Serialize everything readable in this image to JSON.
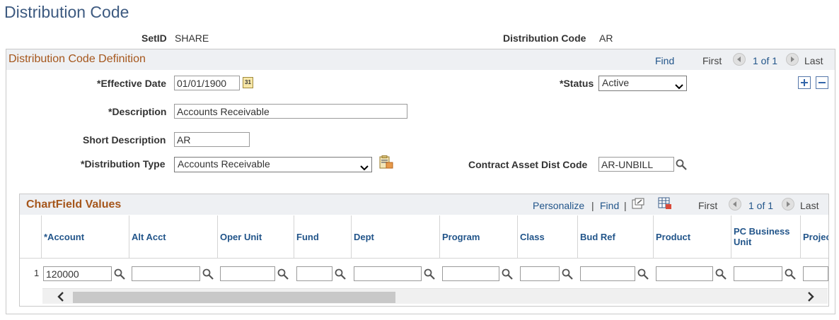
{
  "page_title": "Distribution Code",
  "header": {
    "setid_label": "SetID",
    "setid_value": "SHARE",
    "distcode_label": "Distribution Code",
    "distcode_value": "AR"
  },
  "definition": {
    "title": "Distribution Code Definition",
    "nav": {
      "find": "Find",
      "first": "First",
      "count": "1 of 1",
      "last": "Last"
    },
    "effective_date_label": "*Effective Date",
    "effective_date_value": "01/01/1900",
    "calendar_day": "31",
    "status_label": "*Status",
    "status_value": "Active",
    "description_label": "*Description",
    "description_value": "Accounts Receivable",
    "short_desc_label": "Short Description",
    "short_desc_value": "AR",
    "dist_type_label": "*Distribution Type",
    "dist_type_value": "Accounts Receivable",
    "contract_label": "Contract Asset Dist Code",
    "contract_value": "AR-UNBILL"
  },
  "chartfield": {
    "title": "ChartField Values",
    "nav": {
      "personalize": "Personalize",
      "sep": "|",
      "find": "Find",
      "first": "First",
      "count": "1 of 1",
      "last": "Last"
    },
    "columns": [
      "*Account",
      "Alt Acct",
      "Oper Unit",
      "Fund",
      "Dept",
      "Program",
      "Class",
      "Bud Ref",
      "Product",
      "PC Business Unit",
      "Projec"
    ],
    "row": {
      "num": "1",
      "values": [
        "120000",
        "",
        "",
        "",
        "",
        "",
        "",
        "",
        "",
        "",
        ""
      ]
    }
  },
  "colors": {
    "title_blue": "#3d5a80",
    "section_orange": "#a5561c",
    "link_blue": "#22558a"
  }
}
